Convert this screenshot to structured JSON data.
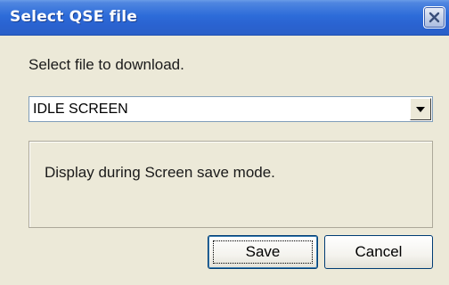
{
  "dialog": {
    "title": "Select QSE file",
    "close_icon": "close-icon",
    "prompt": "Select file to download.",
    "file_select": {
      "selected_value": "IDLE SCREEN",
      "arrow_icon": "chevron-down-icon"
    },
    "description": "Display during Screen save mode.",
    "buttons": {
      "save": "Save",
      "cancel": "Cancel"
    }
  },
  "colors": {
    "titlebar": "#2a63d1",
    "dialog_bg": "#ece9d8",
    "button_border": "#003c74"
  }
}
